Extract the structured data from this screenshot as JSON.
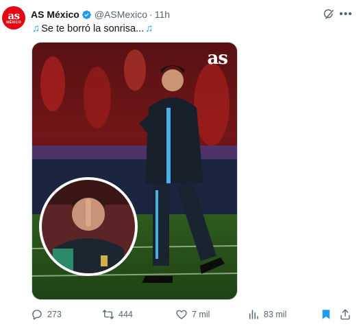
{
  "account": {
    "avatar_top": "as",
    "avatar_bottom": "MÉXICO",
    "display_name": "AS México",
    "handle": "@ASMexico",
    "separator": "·",
    "time": "11h"
  },
  "post": {
    "text": "Se te borró la sonrisa...",
    "emoji_icon": "musical-notes-icon",
    "media_watermark": "as"
  },
  "actions": {
    "replies": "273",
    "reposts": "444",
    "likes": "7 mil",
    "views": "83 mil"
  },
  "colors": {
    "verified": "#1d9bf0",
    "bookmark": "#1d9bf0",
    "muted_text": "#536471",
    "avatar_bg": "#e30613"
  }
}
